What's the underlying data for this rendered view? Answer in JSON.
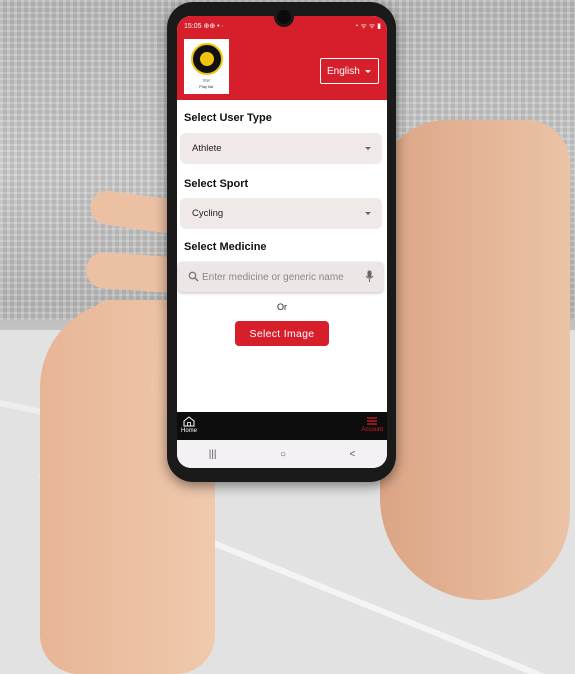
{
  "status_bar": {
    "time": "15:05",
    "icons": "⊕⊕ • ·",
    "right_icons": "◔ ᯤ ᯤ ▮"
  },
  "header": {
    "logo_caption": "Play fair",
    "logo_caption_2": "ঢাকা",
    "language_selected": "English"
  },
  "form": {
    "user_type_label": "Select User Type",
    "user_type_value": "Athlete",
    "sport_label": "Select Sport",
    "sport_value": "Cycling",
    "medicine_label": "Select Medicine",
    "medicine_placeholder": "Enter medicine or generic name",
    "or_text": "Or",
    "select_image_label": "Select Image"
  },
  "bottom_nav": {
    "items": [
      {
        "label": "Home",
        "icon": "home-icon"
      },
      {
        "label": "Account",
        "icon": "menu-icon"
      }
    ]
  },
  "system_nav": {
    "recent": "|||",
    "home": "○",
    "back": "<"
  },
  "colors": {
    "brand_red": "#d71f2b",
    "field_bg": "#efe9e8",
    "nav_bg": "#0d0d0d"
  }
}
